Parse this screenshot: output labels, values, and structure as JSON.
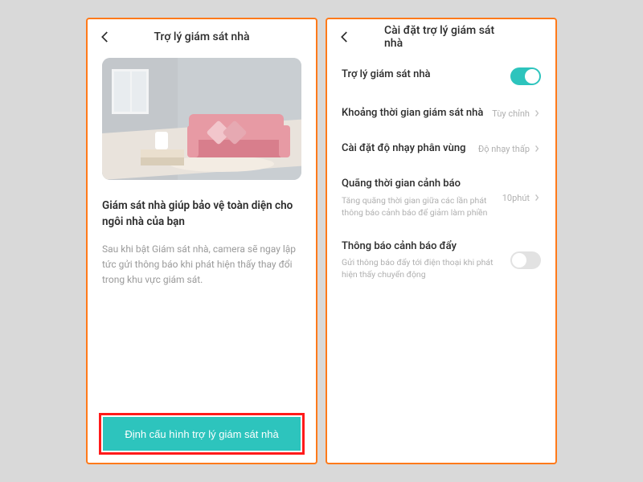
{
  "colors": {
    "accent": "#2dc4bd",
    "highlight_border": "#ff1a1a",
    "frame_border": "#ff7a1a"
  },
  "left": {
    "header_title": "Trợ lý giám sát nhà",
    "intro_title": "Giám sát nhà giúp bảo vệ toàn diện cho ngôi nhà của bạn",
    "intro_desc": "Sau khi bật Giám sát nhà, camera sẽ ngay lập tức gửi thông báo khi phát hiện thấy thay đổi trong khu vực giám sát.",
    "primary_button": "Định cấu hình trợ lý giám sát nhà"
  },
  "right": {
    "header_title": "Cài đặt trợ lý giám sát nhà",
    "rows": {
      "assistant": {
        "title": "Trợ lý giám sát nhà",
        "enabled": true
      },
      "monitor_period": {
        "title": "Khoảng thời gian giám sát nhà",
        "value": "Tùy chỉnh"
      },
      "sensitivity": {
        "title": "Cài đặt độ nhạy phân vùng",
        "value": "Độ nhạy thấp"
      },
      "alert_interval": {
        "title": "Quãng thời gian cảnh báo",
        "desc": "Tăng quãng thời gian giữa các lần phát thông báo cảnh báo để giảm làm phiền",
        "value": "10phút"
      },
      "push_alert": {
        "title": "Thông báo cảnh báo đẩy",
        "desc": "Gửi thông báo đẩy tới điện thoại khi phát hiện thấy chuyển động",
        "enabled": false
      }
    }
  }
}
